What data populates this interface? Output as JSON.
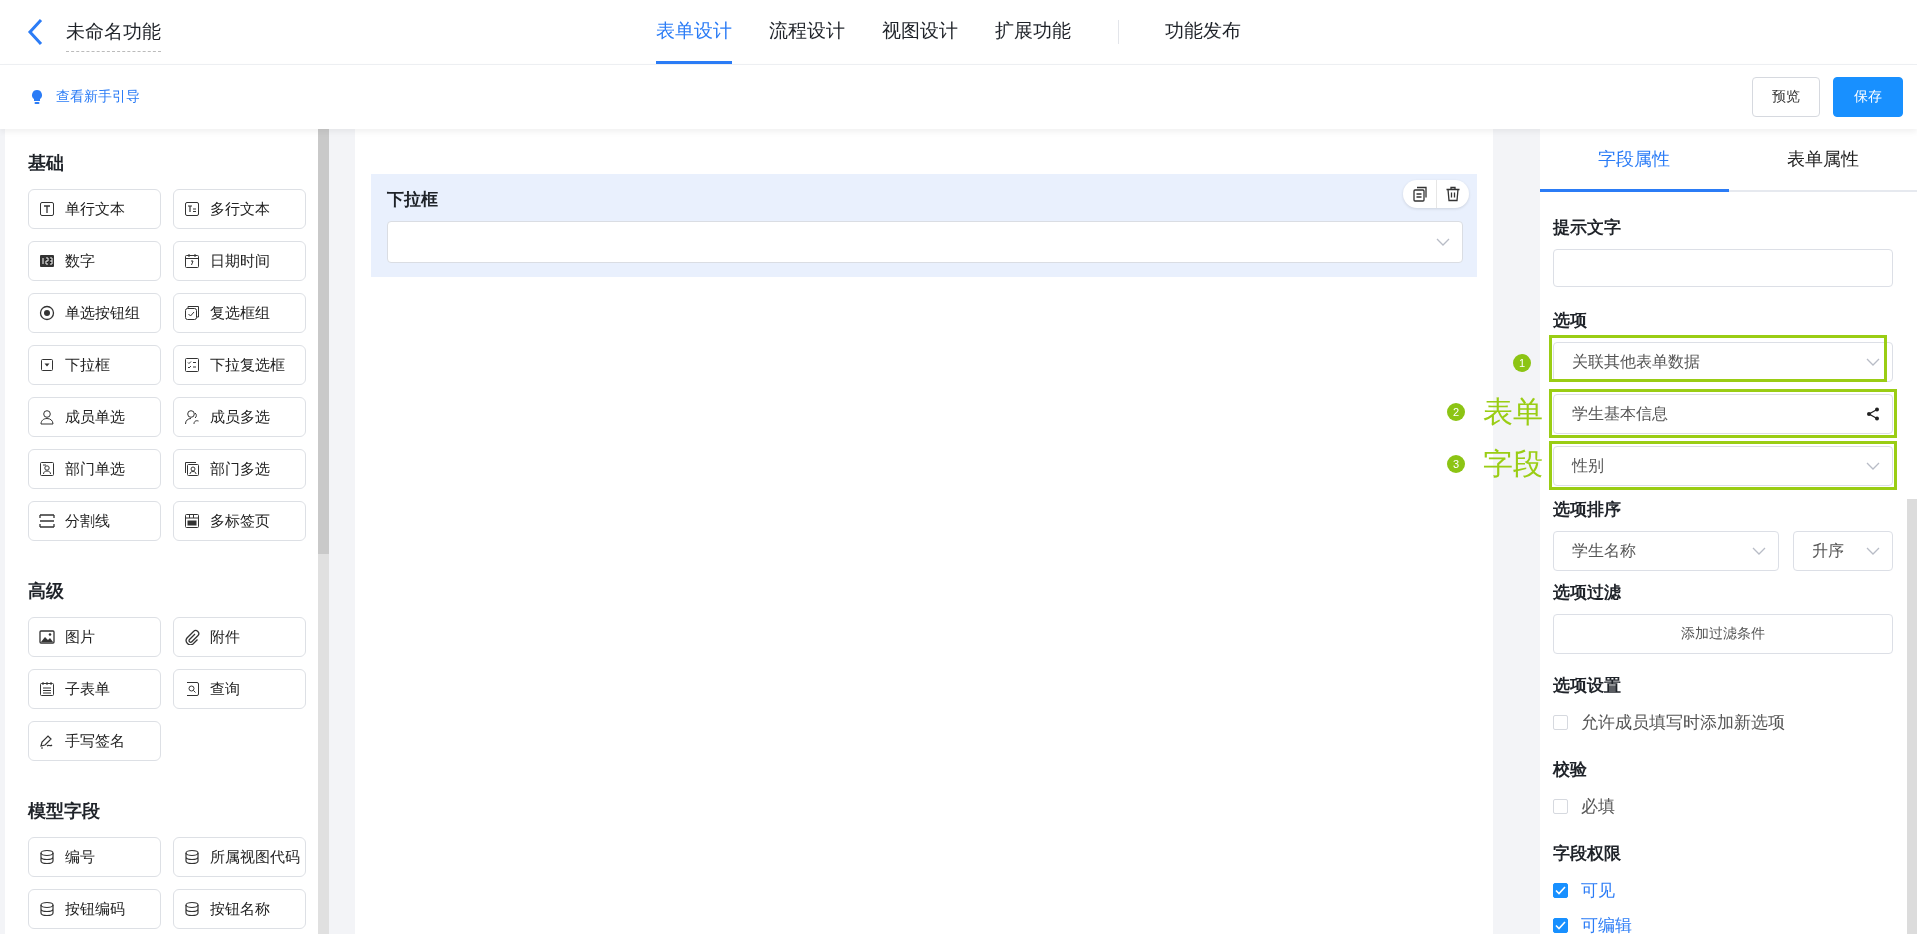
{
  "header": {
    "title": "未命名功能",
    "tabs": [
      {
        "label": "表单设计",
        "selected": true
      },
      {
        "label": "流程设计",
        "selected": false
      },
      {
        "label": "视图设计",
        "selected": false
      },
      {
        "label": "扩展功能",
        "selected": false
      }
    ],
    "publish": "功能发布"
  },
  "toolbar": {
    "guide_link": "查看新手引导",
    "buttons": [
      {
        "label": "预览",
        "kind": "secondary"
      },
      {
        "label": "保存",
        "kind": "primary"
      }
    ]
  },
  "palette": {
    "groups": [
      {
        "title": "基础",
        "items": [
          {
            "label": "单行文本",
            "kind": "text"
          },
          {
            "label": "多行文本",
            "kind": "textarea"
          },
          {
            "label": "数字",
            "kind": "number"
          },
          {
            "label": "日期时间",
            "kind": "date"
          },
          {
            "label": "单选按钮组",
            "kind": "radio"
          },
          {
            "label": "复选框组",
            "kind": "checkbox"
          },
          {
            "label": "下拉框",
            "kind": "select"
          },
          {
            "label": "下拉复选框",
            "kind": "multiselect"
          },
          {
            "label": "成员单选",
            "kind": "user"
          },
          {
            "label": "成员多选",
            "kind": "users"
          },
          {
            "label": "部门单选",
            "kind": "dept"
          },
          {
            "label": "部门多选",
            "kind": "depts"
          },
          {
            "label": "分割线",
            "kind": "divider"
          },
          {
            "label": "多标签页",
            "kind": "tabs"
          }
        ]
      },
      {
        "title": "高级",
        "items": [
          {
            "label": "图片",
            "kind": "image"
          },
          {
            "label": "附件",
            "kind": "attachment"
          },
          {
            "label": "子表单",
            "kind": "subform"
          },
          {
            "label": "查询",
            "kind": "query"
          },
          {
            "label": "手写签名",
            "kind": "signature"
          }
        ]
      },
      {
        "title": "模型字段",
        "items": [
          {
            "label": "编号",
            "kind": "database"
          },
          {
            "label": "所属视图代码",
            "kind": "database"
          },
          {
            "label": "按钮编码",
            "kind": "database"
          },
          {
            "label": "按钮名称",
            "kind": "database"
          }
        ]
      }
    ]
  },
  "canvas": {
    "field": {
      "label": "下拉框",
      "selected": true
    }
  },
  "properties": {
    "tabs": [
      {
        "label": "字段属性",
        "selected": true
      },
      {
        "label": "表单属性",
        "selected": false
      }
    ],
    "placeholder_label": "提示文字",
    "options_label": "选项",
    "source_select": {
      "value": "关联其他表单数据",
      "annotation": {
        "number": "1"
      }
    },
    "form_select": {
      "value": "学生基本信息",
      "annotation": {
        "number": "2",
        "label": "表单"
      }
    },
    "field_select": {
      "value": "性别",
      "annotation": {
        "number": "3",
        "label": "字段"
      }
    },
    "sort_label": "选项排序",
    "sort_field": "学生名称",
    "sort_order": "升序",
    "filter_label": "选项过滤",
    "filter_button": "添加过滤条件",
    "settings_label": "选项设置",
    "settings_options": [
      {
        "label": "允许成员填写时添加新选项",
        "checked": false
      }
    ],
    "validation_label": "校验",
    "validation_options": [
      {
        "label": "必填",
        "checked": false
      }
    ],
    "permissions_label": "字段权限",
    "permission_options": [
      {
        "label": "可见",
        "checked": true
      },
      {
        "label": "可编辑",
        "checked": true
      }
    ]
  }
}
